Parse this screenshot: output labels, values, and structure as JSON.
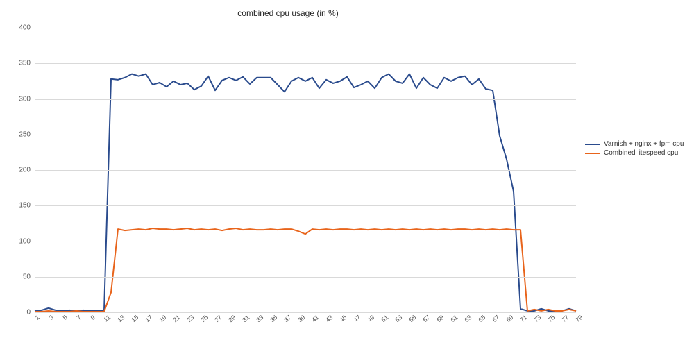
{
  "chart_data": {
    "type": "line",
    "title": "combined cpu usage (in %)",
    "xlabel": "",
    "ylabel": "",
    "ylim": [
      0,
      400
    ],
    "yticks": [
      0,
      50,
      100,
      150,
      200,
      250,
      300,
      350,
      400
    ],
    "categories": [
      1,
      2,
      3,
      4,
      5,
      6,
      7,
      8,
      9,
      10,
      11,
      12,
      13,
      14,
      15,
      16,
      17,
      18,
      19,
      20,
      21,
      22,
      23,
      24,
      25,
      26,
      27,
      28,
      29,
      30,
      31,
      32,
      33,
      34,
      35,
      36,
      37,
      38,
      39,
      40,
      41,
      42,
      43,
      44,
      45,
      46,
      47,
      48,
      49,
      50,
      51,
      52,
      53,
      54,
      55,
      56,
      57,
      58,
      59,
      60,
      61,
      62,
      63,
      64,
      65,
      66,
      67,
      68,
      69,
      70,
      71,
      72,
      73,
      74,
      75,
      76,
      77,
      78,
      79
    ],
    "xticks": [
      1,
      3,
      5,
      7,
      9,
      11,
      13,
      15,
      17,
      19,
      21,
      23,
      25,
      27,
      29,
      31,
      33,
      35,
      37,
      39,
      41,
      43,
      45,
      47,
      49,
      51,
      53,
      55,
      57,
      59,
      61,
      63,
      65,
      67,
      69,
      71,
      73,
      75,
      77,
      79
    ],
    "series": [
      {
        "name": "Varnish + nginx + fpm cpu",
        "color": "#2a4b8d",
        "values": [
          2,
          3,
          6,
          3,
          2,
          3,
          2,
          3,
          2,
          2,
          2,
          328,
          327,
          330,
          335,
          332,
          335,
          320,
          323,
          317,
          325,
          320,
          322,
          313,
          318,
          332,
          312,
          326,
          330,
          326,
          331,
          321,
          330,
          330,
          330,
          320,
          310,
          325,
          330,
          325,
          330,
          315,
          327,
          322,
          325,
          331,
          316,
          320,
          325,
          315,
          330,
          335,
          325,
          322,
          335,
          315,
          330,
          320,
          315,
          330,
          325,
          330,
          332,
          320,
          328,
          314,
          312,
          248,
          215,
          170,
          5,
          2,
          2,
          5,
          2,
          2,
          2,
          5,
          2
        ]
      },
      {
        "name": "Combined litespeed cpu",
        "color": "#e8641b",
        "values": [
          1,
          1,
          2,
          1,
          1,
          1,
          2,
          1,
          1,
          1,
          1,
          28,
          117,
          115,
          116,
          117,
          116,
          118,
          117,
          117,
          116,
          117,
          118,
          116,
          117,
          116,
          117,
          115,
          117,
          118,
          116,
          117,
          116,
          116,
          117,
          116,
          117,
          117,
          114,
          110,
          117,
          116,
          117,
          116,
          117,
          117,
          116,
          117,
          116,
          117,
          116,
          117,
          116,
          117,
          116,
          117,
          116,
          117,
          116,
          117,
          116,
          117,
          117,
          116,
          117,
          116,
          117,
          116,
          117,
          116,
          116,
          2,
          4,
          2,
          4,
          2,
          2,
          4,
          2
        ]
      }
    ],
    "legend_position": "right"
  }
}
